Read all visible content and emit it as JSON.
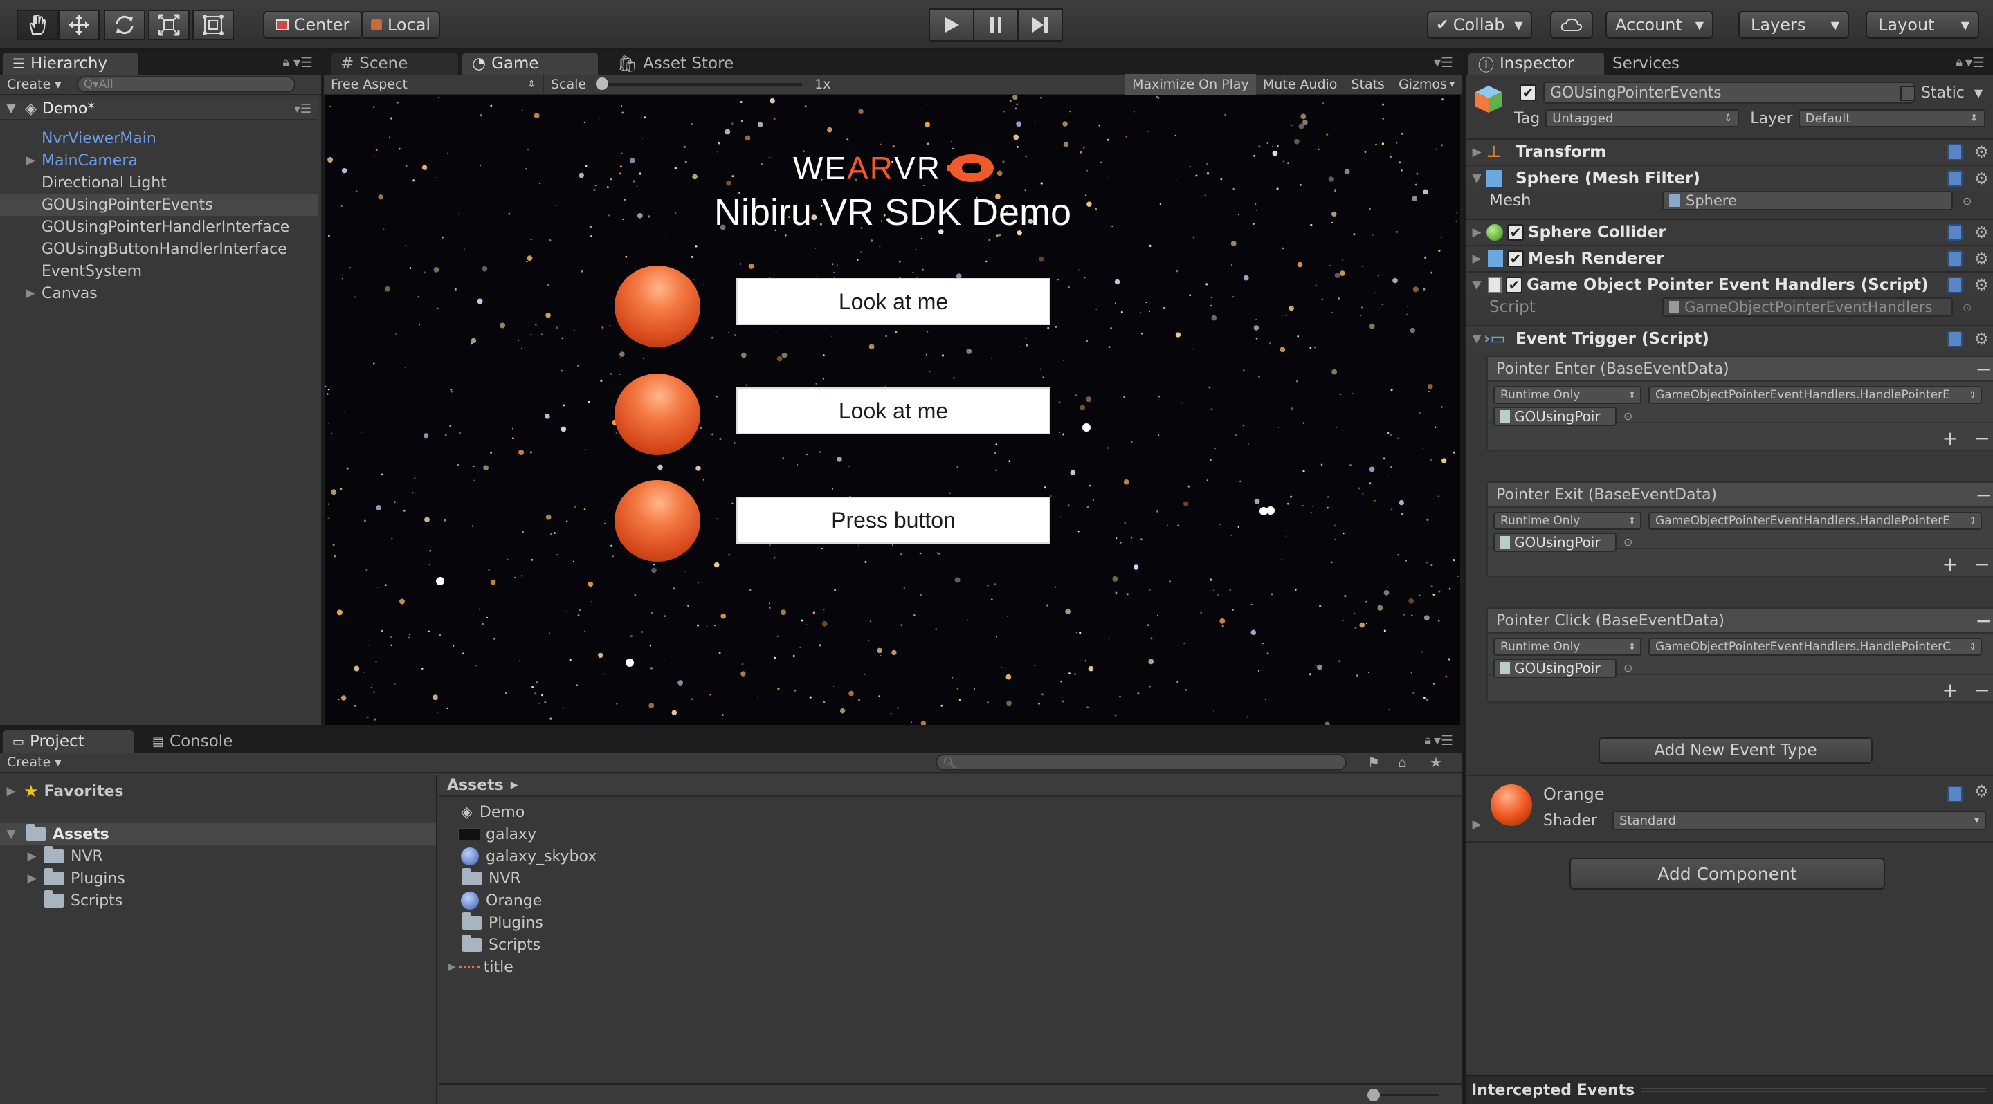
{
  "toolbar": {
    "pivot_center": "Center",
    "pivot_local": "Local",
    "collab": "Collab",
    "account": "Account",
    "layers": "Layers",
    "layout": "Layout"
  },
  "hierarchy": {
    "tab": "Hierarchy",
    "create": "Create",
    "search_placeholder": "Q▾All",
    "scene": "Demo*",
    "items": [
      {
        "label": "NvrViewerMain",
        "style": "blue"
      },
      {
        "label": "MainCamera",
        "style": "blue"
      },
      {
        "label": "Directional Light",
        "style": ""
      },
      {
        "label": "GOUsingPointerEvents",
        "style": "selected"
      },
      {
        "label": "GOUsingPointerHandlerInterface",
        "style": ""
      },
      {
        "label": "GOUsingButtonHandlerInterface",
        "style": ""
      },
      {
        "label": "EventSystem",
        "style": ""
      },
      {
        "label": "Canvas",
        "style": ""
      }
    ]
  },
  "center_tabs": {
    "scene": "Scene",
    "game": "Game",
    "asset_store": "Asset Store"
  },
  "game_bar": {
    "aspect": "Free Aspect",
    "scale_label": "Scale",
    "scale_value": "1x",
    "maximize": "Maximize On Play",
    "mute": "Mute Audio",
    "stats": "Stats",
    "gizmos": "Gizmos"
  },
  "game": {
    "logo_we": "WE",
    "logo_ar": "AR",
    "logo_vr": "VR",
    "title": "Nibiru VR SDK Demo",
    "buttons": [
      "Look at me",
      "Look at me",
      "Press button"
    ]
  },
  "inspector": {
    "tab": "Inspector",
    "services_tab": "Services",
    "object_name": "GOUsingPointerEvents",
    "static_label": "Static",
    "tag_label": "Tag",
    "tag_value": "Untagged",
    "layer_label": "Layer",
    "layer_value": "Default",
    "components": {
      "transform": "Transform",
      "mesh_filter": "Sphere (Mesh Filter)",
      "mesh_label": "Mesh",
      "mesh_value": "Sphere",
      "sphere_collider": "Sphere Collider",
      "mesh_renderer": "Mesh Renderer",
      "script_comp": "Game Object Pointer Event Handlers (Script)",
      "script_label": "Script",
      "script_value": "GameObjectPointerEventHandlers",
      "event_trigger": "Event Trigger (Script)"
    },
    "events": [
      {
        "header": "Pointer Enter (BaseEventData)",
        "runtime": "Runtime Only",
        "method": "GameObjectPointerEventHandlers.HandlePointerE",
        "target": "GOUsingPoir"
      },
      {
        "header": "Pointer Exit (BaseEventData)",
        "runtime": "Runtime Only",
        "method": "GameObjectPointerEventHandlers.HandlePointerE",
        "target": "GOUsingPoir"
      },
      {
        "header": "Pointer Click (BaseEventData)",
        "runtime": "Runtime Only",
        "method": "GameObjectPointerEventHandlers.HandlePointerC",
        "target": "GOUsingPoir"
      }
    ],
    "add_event_type": "Add New Event Type",
    "material_name": "Orange",
    "shader_label": "Shader",
    "shader_value": "Standard",
    "add_component": "Add Component",
    "intercepted": "Intercepted Events"
  },
  "project": {
    "tab": "Project",
    "console_tab": "Console",
    "create": "Create",
    "favorites": "Favorites",
    "assets_root": "Assets",
    "tree": [
      "NVR",
      "Plugins",
      "Scripts"
    ],
    "breadcrumb": "Assets",
    "assets": [
      {
        "label": "Demo",
        "icon": "unity-scene"
      },
      {
        "label": "galaxy",
        "icon": "texture"
      },
      {
        "label": "galaxy_skybox",
        "icon": "material"
      },
      {
        "label": "NVR",
        "icon": "folder"
      },
      {
        "label": "Orange",
        "icon": "material"
      },
      {
        "label": "Plugins",
        "icon": "folder"
      },
      {
        "label": "Scripts",
        "icon": "folder"
      },
      {
        "label": "title",
        "icon": "sprite"
      }
    ]
  }
}
